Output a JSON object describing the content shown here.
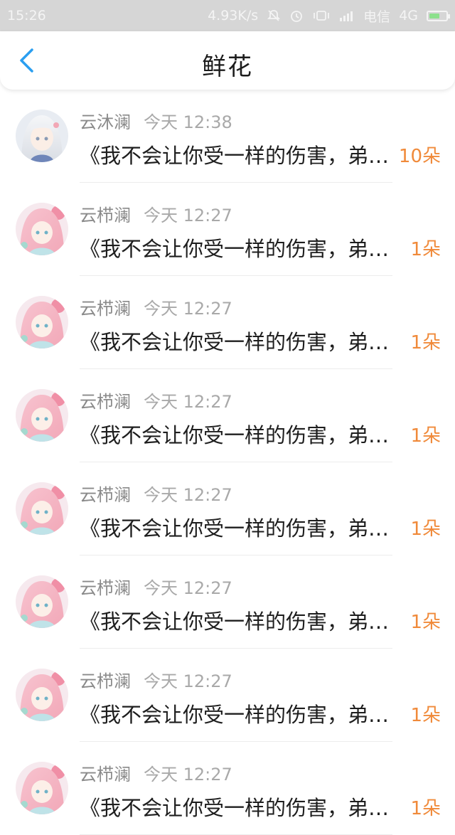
{
  "status_bar": {
    "time": "15:26",
    "speed": "4.93K/s",
    "carrier": "电信",
    "network": "4G"
  },
  "nav": {
    "title": "鲜花"
  },
  "colors": {
    "accent": "#2a9ef0",
    "count": "#f08a3a"
  },
  "items": [
    {
      "name": "云沐澜",
      "time": "今天 12:38",
      "message": "《我不会让你受一样的伤害，弟弟》",
      "count": "10朵"
    },
    {
      "name": "云栉澜",
      "time": "今天 12:27",
      "message": "《我不会让你受一样的伤害，弟弟》",
      "count": "1朵"
    },
    {
      "name": "云栉澜",
      "time": "今天 12:27",
      "message": "《我不会让你受一样的伤害，弟弟》",
      "count": "1朵"
    },
    {
      "name": "云栉澜",
      "time": "今天 12:27",
      "message": "《我不会让你受一样的伤害，弟弟》",
      "count": "1朵"
    },
    {
      "name": "云栉澜",
      "time": "今天 12:27",
      "message": "《我不会让你受一样的伤害，弟弟》",
      "count": "1朵"
    },
    {
      "name": "云栉澜",
      "time": "今天 12:27",
      "message": "《我不会让你受一样的伤害，弟弟》",
      "count": "1朵"
    },
    {
      "name": "云栉澜",
      "time": "今天 12:27",
      "message": "《我不会让你受一样的伤害，弟弟》",
      "count": "1朵"
    },
    {
      "name": "云栉澜",
      "time": "今天 12:27",
      "message": "《我不会让你受一样的伤害，弟弟》",
      "count": "1朵"
    }
  ]
}
